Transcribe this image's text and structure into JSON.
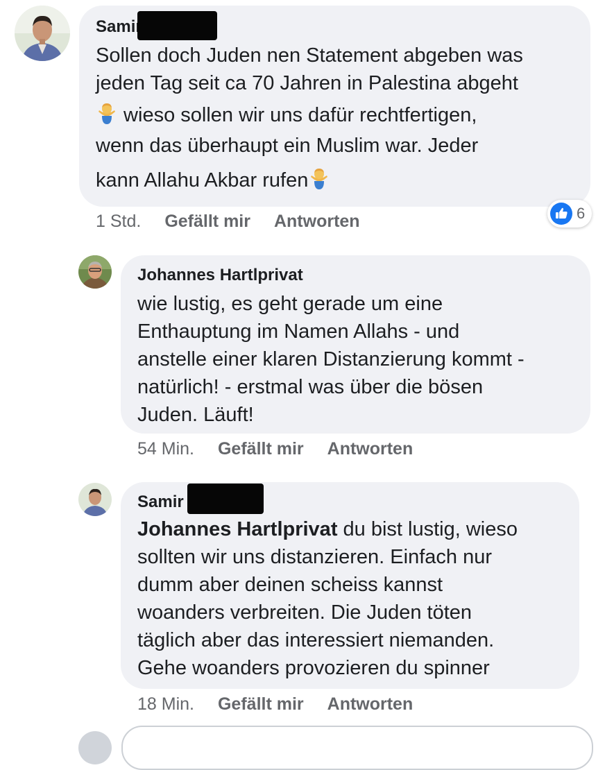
{
  "comments": [
    {
      "author": "Samir",
      "body_lines": [
        "Sollen doch Juden nen Statement abgeben was",
        "jeden Tag seit ca 70 Jahren in Palestina abgeht",
        " wieso sollen wir uns dafür rechtfertigen,",
        "wenn das überhaupt ein Muslim war. Jeder",
        "kann Allahu Akbar rufen"
      ],
      "time": "1 Std.",
      "like_label": "Gefällt mir",
      "reply_label": "Antworten",
      "reaction_count": "6"
    },
    {
      "author": "Johannes Hartlprivat",
      "body_lines": [
        "wie lustig, es geht gerade um eine",
        "Enthauptung im Namen Allahs - und",
        "anstelle einer klaren Distanzierung kommt -",
        "natürlich! - erstmal was über die bösen",
        "Juden. Läuft!"
      ],
      "time": "54 Min.",
      "like_label": "Gefällt mir",
      "reply_label": "Antworten"
    },
    {
      "author": "Samir",
      "mention": "Johannes Hartlprivat",
      "body_lines": [
        " du bist lustig, wieso",
        "sollten wir uns distanzieren. Einfach nur",
        "dumm aber deinen scheiss kannst",
        "woanders verbreiten. Die Juden töten",
        "täglich aber das interessiert niemanden.",
        "Gehe woanders provozieren du spinner"
      ],
      "time": "18 Min.",
      "like_label": "Gefällt mir",
      "reply_label": "Antworten"
    }
  ],
  "colors": {
    "bubble": "#f0f1f5",
    "meta_text": "#65676b",
    "like_blue": "#1877f2"
  },
  "icons": {
    "reaction": "thumbs-up-icon",
    "emoji": "person-shrugging-icon"
  }
}
